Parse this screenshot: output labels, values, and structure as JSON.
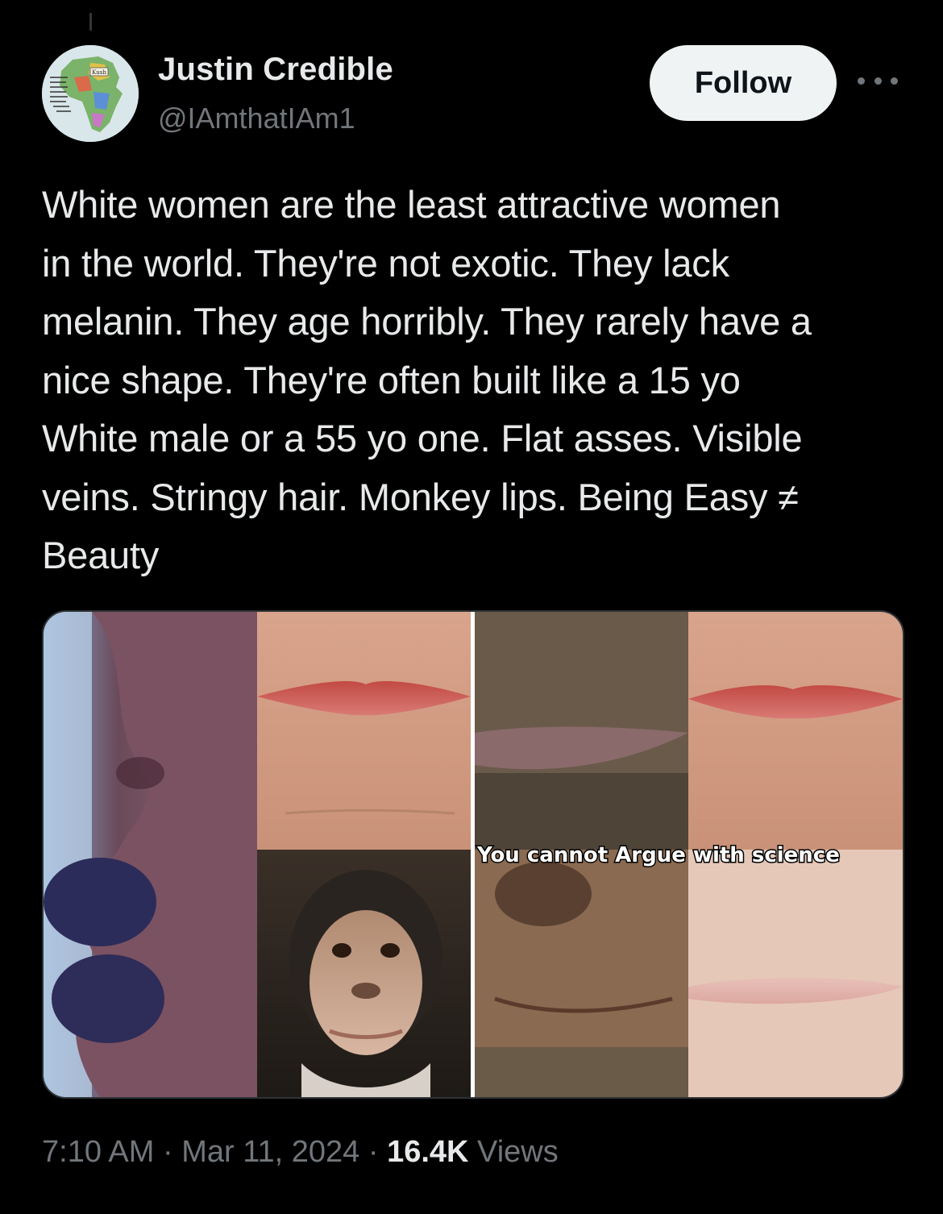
{
  "author": {
    "display_name": "Justin Credible",
    "handle": "@IAmthatIAm1",
    "avatar_icon": "africa-map-avatar"
  },
  "follow_label": "Follow",
  "more_icon": "more-horizontal-icon",
  "tweet": {
    "text": "White women are the least attractive women\nin the world. They're not exotic. They lack\nmelanin. They age horribly. They rarely have a\nnice shape. They're often built like a 15 yo\nWhite male or a 55 yo one. Flat asses. Visible\nveins. Stringy hair. Monkey lips. Being Easy ≠\nBeauty"
  },
  "media": {
    "left_caption": "",
    "right_caption": "You cannot Argue with science"
  },
  "meta": {
    "time": "7:10 AM",
    "sep1": " · ",
    "date": "Mar 11, 2024",
    "sep2": " · ",
    "views_count": "16.4K",
    "views_label": " Views"
  },
  "colors": {
    "background": "#000000",
    "primary_text": "#e7e9ea",
    "secondary_text": "#71767b",
    "follow_bg": "#eff3f4"
  }
}
